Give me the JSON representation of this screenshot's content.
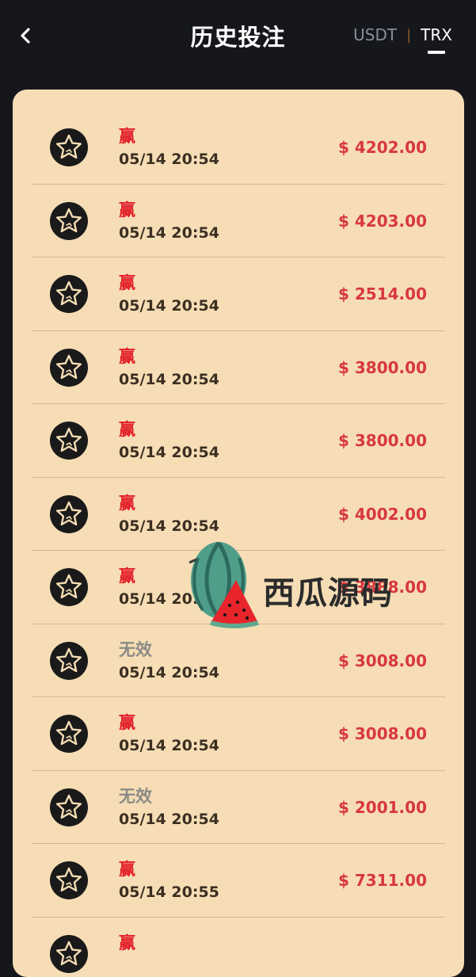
{
  "header": {
    "title": "历史投注",
    "tabs": [
      {
        "label": "USDT",
        "active": false
      },
      {
        "label": "TRX",
        "active": true
      }
    ],
    "separator": "|"
  },
  "records": [
    {
      "status": "赢",
      "type": "win",
      "time": "05/14 20:54",
      "amount": "$ 4202.00"
    },
    {
      "status": "赢",
      "type": "win",
      "time": "05/14 20:54",
      "amount": "$ 4203.00"
    },
    {
      "status": "赢",
      "type": "win",
      "time": "05/14 20:54",
      "amount": "$ 2514.00"
    },
    {
      "status": "赢",
      "type": "win",
      "time": "05/14 20:54",
      "amount": "$ 3800.00"
    },
    {
      "status": "赢",
      "type": "win",
      "time": "05/14 20:54",
      "amount": "$ 3800.00"
    },
    {
      "status": "赢",
      "type": "win",
      "time": "05/14 20:54",
      "amount": "$ 4002.00"
    },
    {
      "status": "赢",
      "type": "win",
      "time": "05/14 20:54",
      "amount": "$ 3888.00"
    },
    {
      "status": "无效",
      "type": "invalid",
      "time": "05/14 20:54",
      "amount": "$ 3008.00"
    },
    {
      "status": "赢",
      "type": "win",
      "time": "05/14 20:54",
      "amount": "$ 3008.00"
    },
    {
      "status": "无效",
      "type": "invalid",
      "time": "05/14 20:54",
      "amount": "$ 2001.00"
    },
    {
      "status": "赢",
      "type": "win",
      "time": "05/14 20:55",
      "amount": "$ 7311.00"
    },
    {
      "status": "赢",
      "type": "win",
      "time": "",
      "amount": ""
    }
  ],
  "watermark": {
    "text": "西瓜源码",
    "icon": "watermelon-icon"
  },
  "colors": {
    "background": "#15171c",
    "card": "#f6ddb5",
    "win": "#e3202a",
    "invalid": "#8b8b86",
    "amount": "#d8383d",
    "divider": "#d4b892"
  }
}
